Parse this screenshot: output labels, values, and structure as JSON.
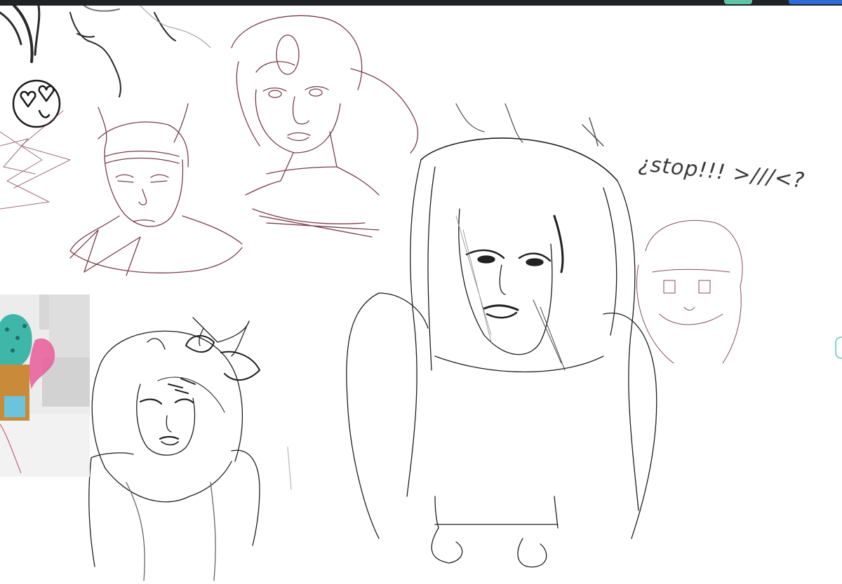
{
  "canvas": {
    "background": "#ffffff",
    "sketches": [
      {
        "name": "face-closeup-top",
        "ink": "#2a2a2a"
      },
      {
        "name": "heart-emoji-doodle",
        "ink": "#1a1a1a"
      },
      {
        "name": "horned-character-head",
        "ink": "#7a3c4a"
      },
      {
        "name": "freckled-character-head",
        "ink": "#7a3c4a"
      },
      {
        "name": "long-haired-figure",
        "ink": "#1e1e1e"
      },
      {
        "name": "small-fuzzy-head",
        "ink": "#8a4b5a"
      },
      {
        "name": "bow-girl-portrait",
        "ink": "#1e1e1e"
      }
    ],
    "handwritten_text": "¿stop!!! >///<?"
  },
  "reference_image": {
    "colors": [
      "#3fb7a8",
      "#e95c9a",
      "#c98a3a",
      "#ececec"
    ]
  },
  "topbar": {
    "background": "#1f2226",
    "accent_teal": "#5ec4a6",
    "accent_blue": "#2f6bd6"
  }
}
